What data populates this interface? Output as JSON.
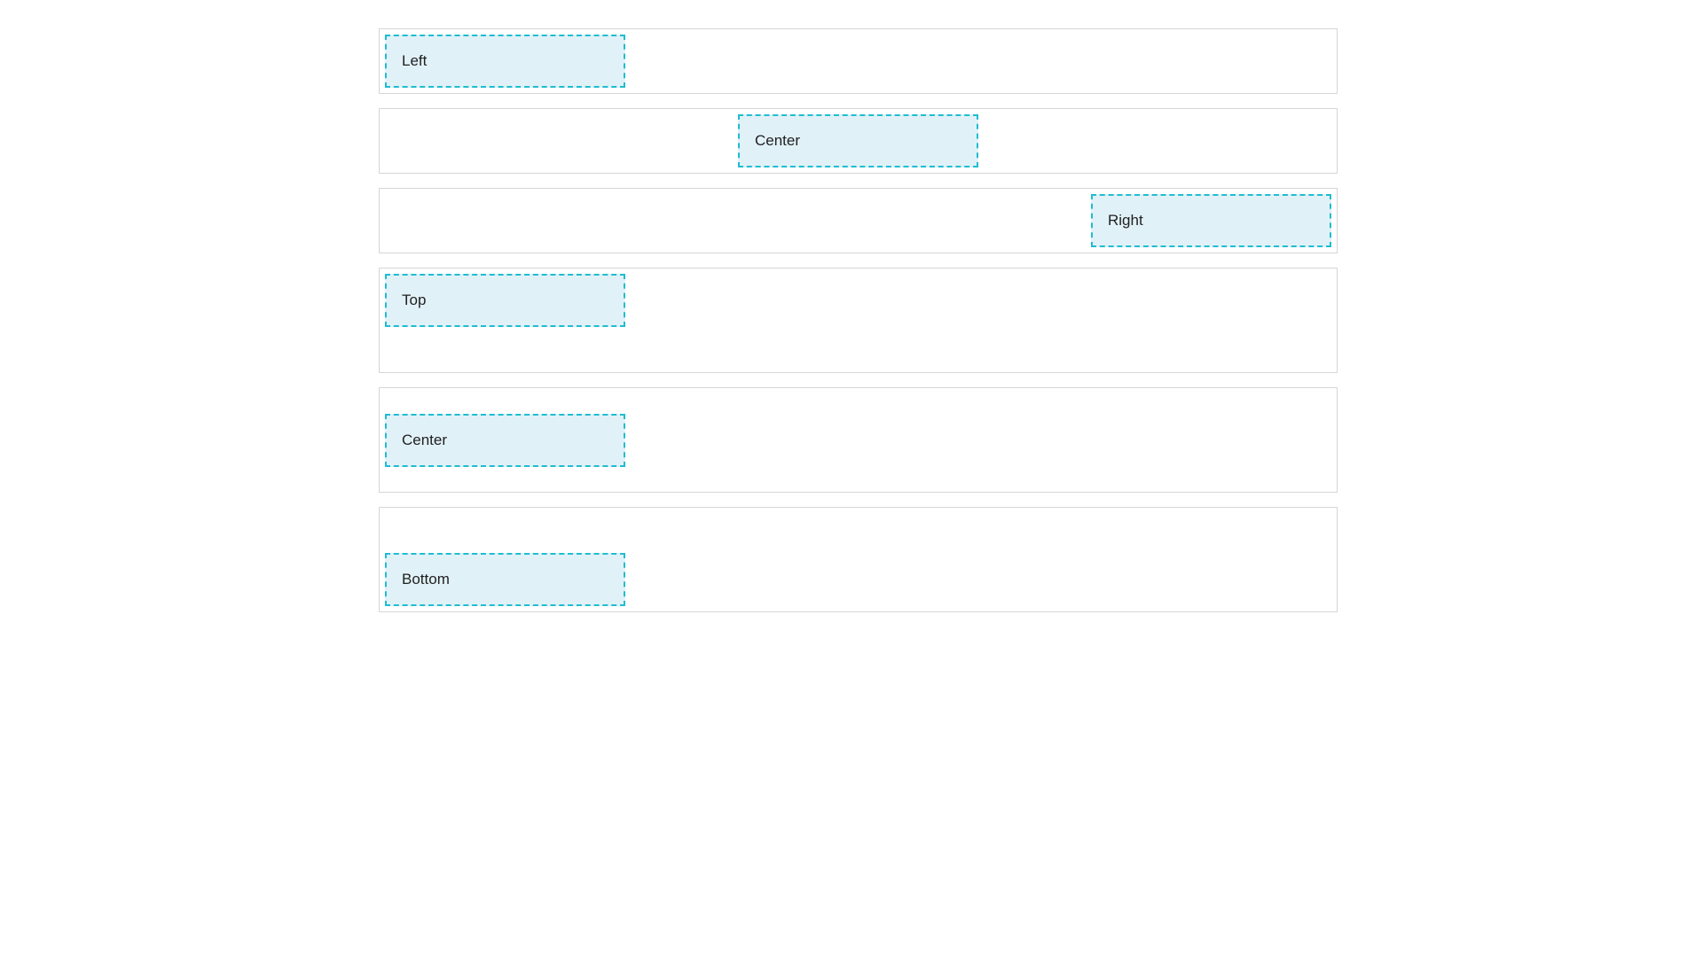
{
  "rows": [
    {
      "label": "Left"
    },
    {
      "label": "Center"
    },
    {
      "label": "Right"
    },
    {
      "label": "Top"
    },
    {
      "label": "Center"
    },
    {
      "label": "Bottom"
    }
  ],
  "colors": {
    "box_fill": "#e1f1f8",
    "box_border": "#1ebdd0",
    "row_border": "#d6d6d6"
  }
}
